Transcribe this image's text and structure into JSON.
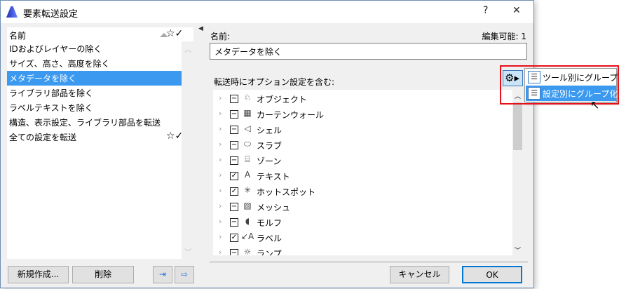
{
  "window": {
    "title": "要素転送設定",
    "help": "?",
    "close": "✕"
  },
  "list": {
    "header": "名前",
    "items": [
      {
        "label": "IDおよびレイヤーの除く",
        "selected": false,
        "starred": false
      },
      {
        "label": "サイズ、高さ、高度を除く",
        "selected": false,
        "starred": false
      },
      {
        "label": "メタデータを除く",
        "selected": true,
        "starred": false
      },
      {
        "label": "ライブラリ部品を除く",
        "selected": false,
        "starred": false
      },
      {
        "label": "ラベルテキストを除く",
        "selected": false,
        "starred": false
      },
      {
        "label": "構造、表示設定、ライブラリ部品を転送",
        "selected": false,
        "starred": false
      },
      {
        "label": "全ての設定を転送",
        "selected": false,
        "starred": true
      }
    ]
  },
  "buttons": {
    "new": "新規作成...",
    "delete": "削除",
    "cancel": "キャンセル",
    "ok": "OK"
  },
  "details": {
    "name_label": "名前:",
    "editable": "編集可能: 1",
    "name_value": "メタデータを除く",
    "options_label": "転送時にオプション設定を含む:"
  },
  "tree": [
    {
      "label": "オブジェクト",
      "state": "partial",
      "icon": "object-icon"
    },
    {
      "label": "カーテンウォール",
      "state": "partial",
      "icon": "curtain-wall-icon"
    },
    {
      "label": "シェル",
      "state": "partial",
      "icon": "shell-icon"
    },
    {
      "label": "スラブ",
      "state": "partial",
      "icon": "slab-icon"
    },
    {
      "label": "ゾーン",
      "state": "partial",
      "icon": "zone-icon"
    },
    {
      "label": "テキスト",
      "state": "checked",
      "icon": "text-icon"
    },
    {
      "label": "ホットスポット",
      "state": "checked",
      "icon": "hotspot-icon"
    },
    {
      "label": "メッシュ",
      "state": "partial",
      "icon": "mesh-icon"
    },
    {
      "label": "モルフ",
      "state": "partial",
      "icon": "morph-icon"
    },
    {
      "label": "ラベル",
      "state": "checked",
      "icon": "label-icon"
    },
    {
      "label": "ランプ",
      "state": "partial",
      "icon": "lamp-icon"
    }
  ],
  "popup": {
    "items": [
      {
        "label": "ツール別にグループ化",
        "highlighted": false
      },
      {
        "label": "設定別にグループ化",
        "highlighted": true
      }
    ]
  },
  "colors": {
    "selection": "#3b99f0",
    "highlight_box": "#e8101a"
  }
}
